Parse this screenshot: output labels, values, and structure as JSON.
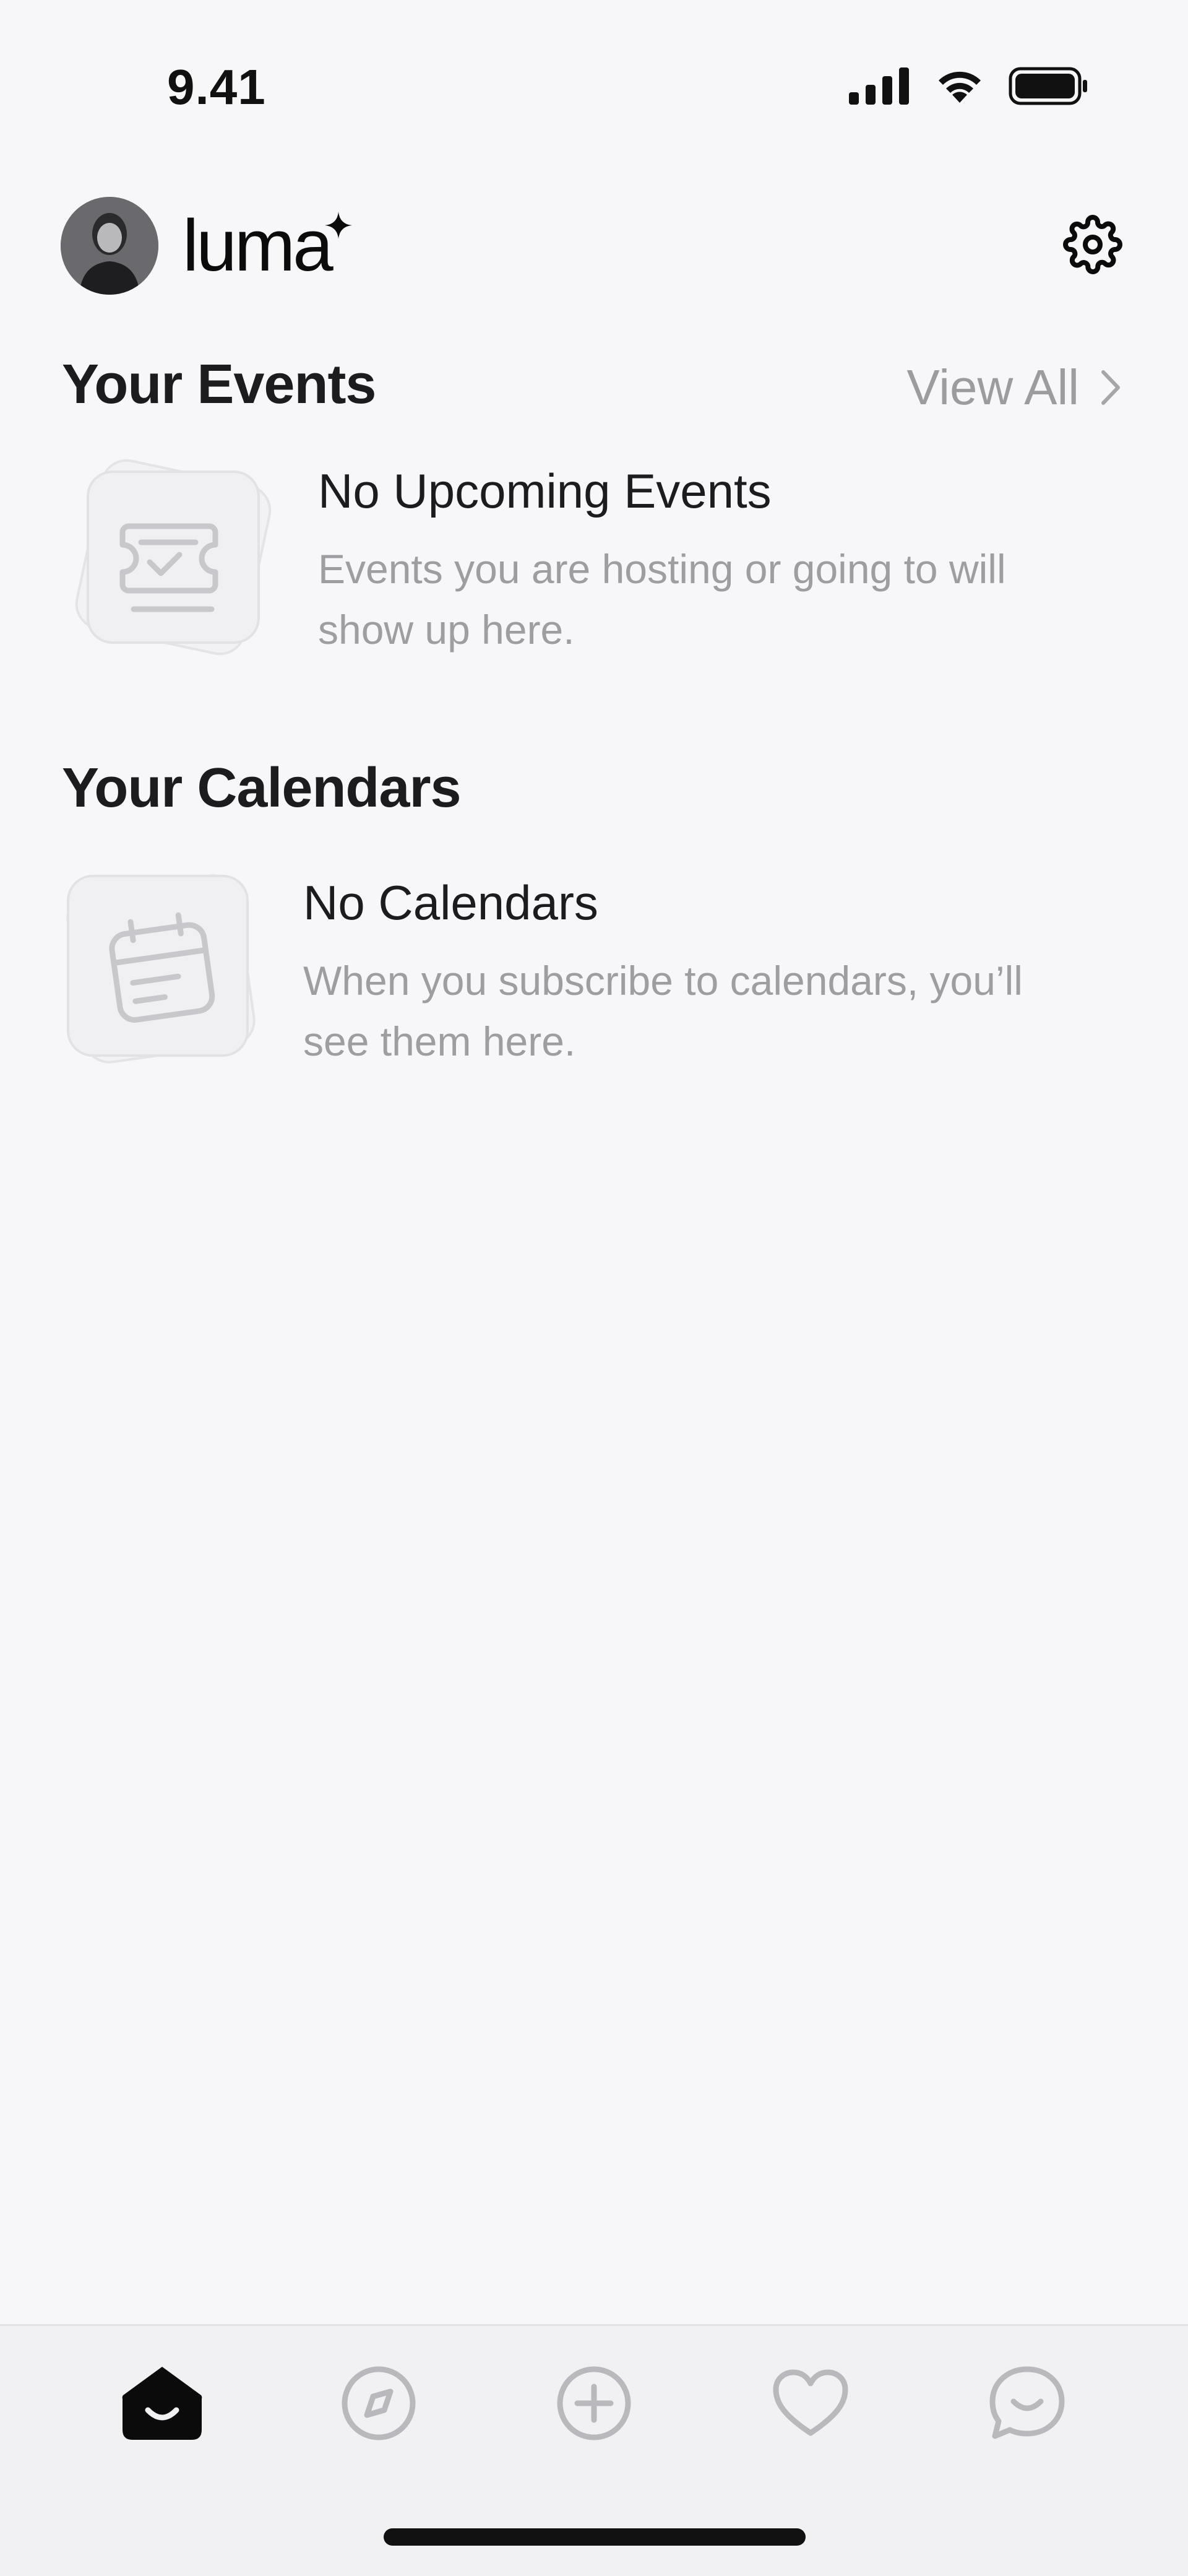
{
  "status_bar": {
    "time": "9.41"
  },
  "header": {
    "logo_text": "luma",
    "icons": [
      "avatar",
      "sparkle-icon",
      "gear-icon"
    ]
  },
  "events": {
    "title": "Your Events",
    "view_all_label": "View All",
    "empty_title": "No Upcoming Events",
    "empty_desc_line1": "Events you are hosting or going to will",
    "empty_desc_line2": "show up here."
  },
  "calendars": {
    "title": "Your Calendars",
    "empty_title": "No Calendars",
    "empty_desc_line1": "When you subscribe to calendars, you’ll",
    "empty_desc_line2": "see them here."
  },
  "tabbar": {
    "tabs": [
      "home-icon",
      "compass-icon",
      "plus-circle-icon",
      "heart-icon",
      "chat-icon"
    ],
    "active": "home-icon"
  },
  "colors": {
    "background": "#f7f7f9",
    "text_primary": "#1c1c1e",
    "text_secondary": "#9d9da2",
    "tabbar_bg": "#f1f1f4"
  }
}
